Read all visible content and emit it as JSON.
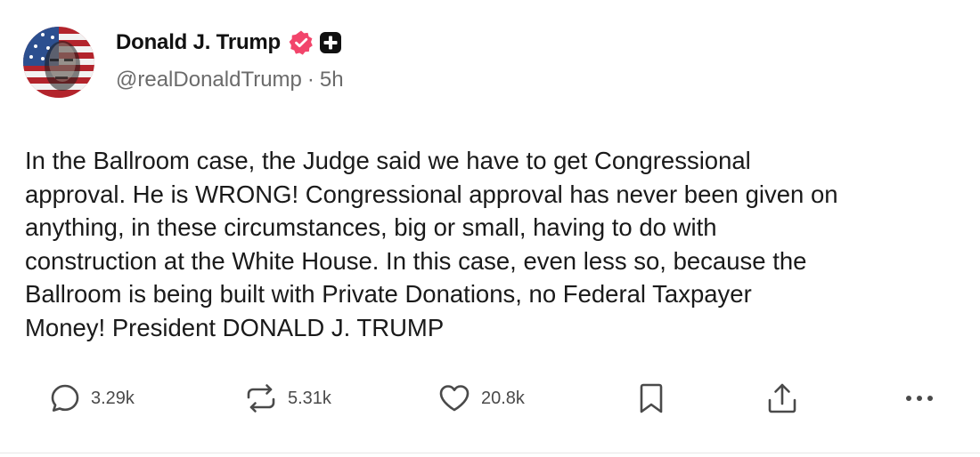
{
  "author": {
    "display_name": "Donald J. Trump",
    "handle": "@realDonaldTrump",
    "separator": "·",
    "time_ago": "5h",
    "verified_badge_color": "#f2456b",
    "plus_badge_color": "#111111"
  },
  "post": {
    "text": "In the Ballroom case, the Judge said we have to get Congressional\napproval. He is WRONG! Congressional approval has never been given on\nanything, in these circumstances, big or small, having to do with\nconstruction at the White House. In this case, even less so, because the\nBallroom is being built with Private Donations, no Federal Taxpayer\nMoney! President DONALD J. TRUMP"
  },
  "actions": {
    "replies": {
      "icon": "reply-icon",
      "count": "3.29k"
    },
    "retruths": {
      "icon": "retruth-icon",
      "count": "5.31k"
    },
    "likes": {
      "icon": "heart-icon",
      "count": "20.8k"
    },
    "bookmark": {
      "icon": "bookmark-icon"
    },
    "share": {
      "icon": "share-icon"
    },
    "more": {
      "icon": "more-icon"
    }
  },
  "colors": {
    "text": "#1a1a1a",
    "muted": "#6b6b6b",
    "icon": "#4a4a4a"
  }
}
